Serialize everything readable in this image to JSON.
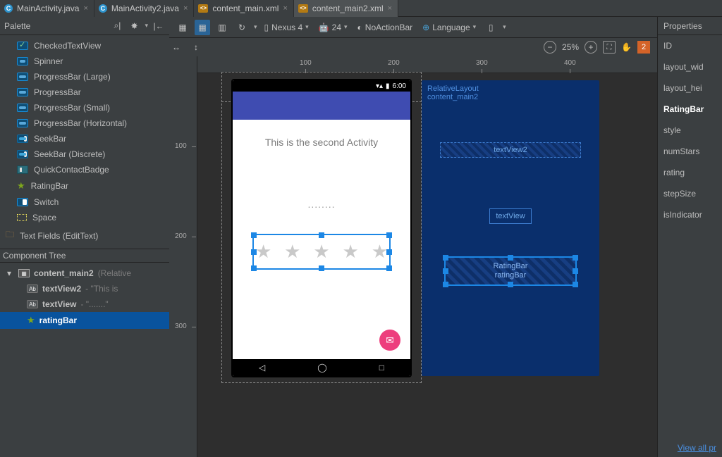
{
  "tabs": [
    {
      "label": "MainActivity.java",
      "type": "c",
      "active": false
    },
    {
      "label": "MainActivity2.java",
      "type": "c",
      "active": false
    },
    {
      "label": "content_main.xml",
      "type": "xml",
      "active": false
    },
    {
      "label": "content_main2.xml",
      "type": "xml",
      "active": true
    }
  ],
  "palette": {
    "title": "Palette",
    "items": [
      {
        "label": "CheckedTextView",
        "icon": "check"
      },
      {
        "label": "Spinner",
        "icon": "spin"
      },
      {
        "label": "ProgressBar (Large)",
        "icon": "prog"
      },
      {
        "label": "ProgressBar",
        "icon": "prog"
      },
      {
        "label": "ProgressBar (Small)",
        "icon": "prog"
      },
      {
        "label": "ProgressBar (Horizontal)",
        "icon": "prog"
      },
      {
        "label": "SeekBar",
        "icon": "seek"
      },
      {
        "label": "SeekBar (Discrete)",
        "icon": "seek"
      },
      {
        "label": "QuickContactBadge",
        "icon": "qcb"
      },
      {
        "label": "RatingBar",
        "icon": "star"
      },
      {
        "label": "Switch",
        "icon": "switch"
      },
      {
        "label": "Space",
        "icon": "space"
      }
    ],
    "folder": "Text Fields (EditText)"
  },
  "component_tree": {
    "title": "Component Tree",
    "root": {
      "label": "content_main2",
      "type": "(Relative"
    },
    "children": [
      {
        "label": "textView2",
        "suffix": " - \"This is",
        "selected": false
      },
      {
        "label": "textView",
        "suffix": " - \".......\"",
        "selected": false
      },
      {
        "label": "ratingBar",
        "suffix": "",
        "selected": true,
        "star": true
      }
    ]
  },
  "toolbar": {
    "device": "Nexus 4",
    "api": "24",
    "theme": "NoActionBar",
    "locale": "Language"
  },
  "zoom": {
    "label": "25%",
    "notif_count": "2"
  },
  "ruler": {
    "h": [
      "100",
      "200",
      "300",
      "400"
    ],
    "v": [
      "100",
      "200",
      "300"
    ]
  },
  "preview": {
    "clock": "6:00",
    "tv1": "This is the second Activity",
    "tv2": "........",
    "nav": {
      "back": "◁",
      "home": "◯",
      "recent": "□"
    }
  },
  "blueprint": {
    "root1": "RelativeLayout",
    "root2": "content_main2",
    "tv2": "textView2",
    "tv": "textView",
    "rb1": "RatingBar",
    "rb2": "ratingBar"
  },
  "properties": {
    "title": "Properties",
    "rows": [
      {
        "label": "ID",
        "sel": false
      },
      {
        "label": "layout_wid",
        "sel": false
      },
      {
        "label": "layout_hei",
        "sel": false
      },
      {
        "label": "RatingBar",
        "sel": true
      },
      {
        "label": "style",
        "sel": false
      },
      {
        "label": "numStars",
        "sel": false
      },
      {
        "label": "rating",
        "sel": false
      },
      {
        "label": "stepSize",
        "sel": false
      },
      {
        "label": "isIndicator",
        "sel": false
      }
    ],
    "link": "View all pr"
  }
}
